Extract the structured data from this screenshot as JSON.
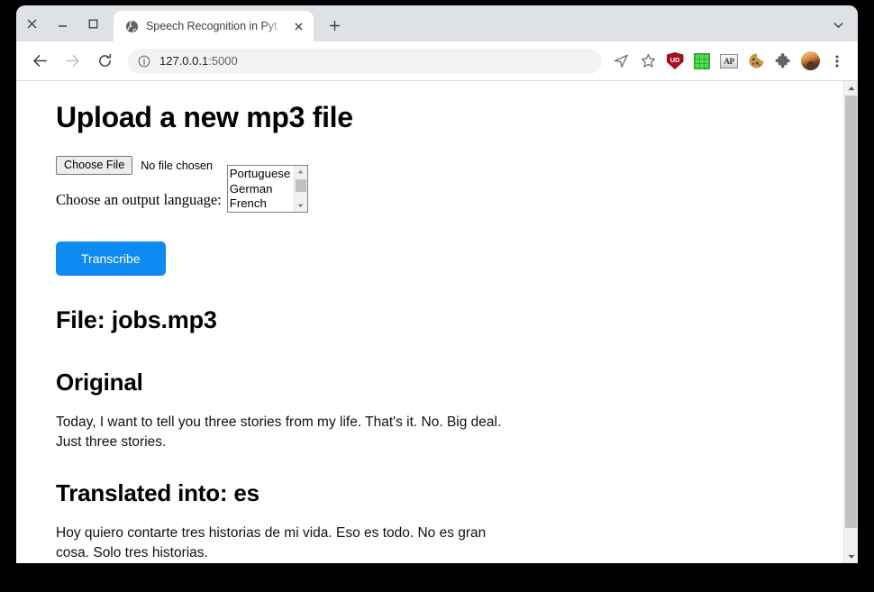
{
  "window": {
    "controls": {
      "close": "close-window",
      "minimize": "minimize-window",
      "maximize": "maximize-window"
    }
  },
  "tabstrip": {
    "active_tab": {
      "title": "Speech Recognition in Pyt",
      "favicon": "globe-icon",
      "close": "close-tab-icon"
    },
    "new_tab_label": "+",
    "tab_list_icon": "chevron-down-icon"
  },
  "toolbar": {
    "back_icon": "back-arrow-icon",
    "forward_icon": "forward-arrow-icon",
    "reload_icon": "reload-icon",
    "site_info_icon": "info-circle-icon",
    "url_host": "127.0.0.1",
    "url_port": ":5000",
    "url_full": "127.0.0.1:5000",
    "actions": [
      {
        "name": "send-to-devices-icon",
        "label": "send"
      },
      {
        "name": "bookmark-star-icon",
        "label": "star"
      },
      {
        "name": "shield-extension-icon",
        "label": "UD"
      },
      {
        "name": "green-grid-extension-icon",
        "label": ""
      },
      {
        "name": "ap-extension-icon",
        "label": "AP"
      },
      {
        "name": "cookie-extension-icon",
        "label": ""
      },
      {
        "name": "puzzle-extensions-icon",
        "label": ""
      },
      {
        "name": "profile-avatar-icon",
        "label": ""
      },
      {
        "name": "chrome-menu-icon",
        "label": "⋮"
      }
    ]
  },
  "page": {
    "heading": "Upload a new mp3 file",
    "upload": {
      "choose_file_button": "Choose File",
      "file_status": "No file chosen",
      "language_label": "Choose an output language:",
      "language_options": [
        "Portuguese",
        "German",
        "French"
      ],
      "submit_button": "Transcribe"
    },
    "result": {
      "file_heading": "File: jobs.mp3",
      "original_heading": "Original",
      "original_text": "Today, I want to tell you three stories from my life. That's it. No. Big deal. Just three stories.",
      "translated_heading": "Translated into: es",
      "translated_text": "Hoy quiero contarte tres historias de mi vida. Eso es todo. No es gran cosa. Solo tres historias."
    }
  },
  "colors": {
    "accent_button": "#0d8bf2",
    "chrome_titlebar": "#dee1e6",
    "omnibox": "#f1f3f4"
  }
}
